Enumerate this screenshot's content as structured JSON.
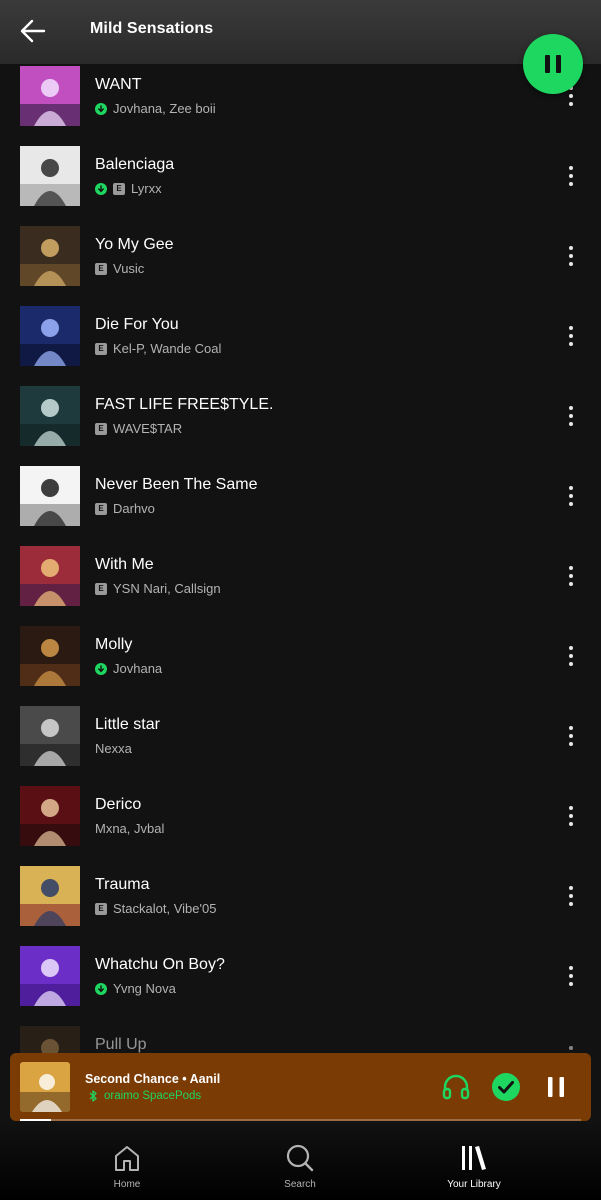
{
  "header": {
    "title": "Mild Sensations"
  },
  "tracks": [
    {
      "title": "WANT",
      "artists": "Jovhana, Zee boii",
      "downloaded": true,
      "explicit": false,
      "art": {
        "bg": "#c24fc0",
        "fg": "#f2e0ff",
        "accent": "#2b1a40"
      }
    },
    {
      "title": "Balenciaga",
      "artists": "Lyrxx",
      "downloaded": true,
      "explicit": true,
      "art": {
        "bg": "#e8e8e8",
        "fg": "#2a2a2a",
        "accent": "#9a9a9a"
      }
    },
    {
      "title": "Yo My Gee",
      "artists": "Vusic",
      "downloaded": false,
      "explicit": true,
      "art": {
        "bg": "#3a2c1e",
        "fg": "#d9b26b",
        "accent": "#7a5a2e"
      }
    },
    {
      "title": "Die For You",
      "artists": "Kel-P, Wande Coal",
      "downloaded": false,
      "explicit": true,
      "art": {
        "bg": "#1b2a6b",
        "fg": "#9fb6ff",
        "accent": "#0a0f2a"
      }
    },
    {
      "title": "FAST LIFE FREE$TYLE.",
      "artists": "WAVE$TAR",
      "downloaded": false,
      "explicit": true,
      "art": {
        "bg": "#1f3a3c",
        "fg": "#cfe3e0",
        "accent": "#0f1f20"
      }
    },
    {
      "title": "Never Been The Same",
      "artists": "Darhvo",
      "downloaded": false,
      "explicit": true,
      "art": {
        "bg": "#f4f4f4",
        "fg": "#1c1c1c",
        "accent": "#7d7d7d"
      }
    },
    {
      "title": "With Me",
      "artists": "YSN Nari, Callsign",
      "downloaded": false,
      "explicit": true,
      "art": {
        "bg": "#9c2c3a",
        "fg": "#f1c27a",
        "accent": "#3c1a4a"
      }
    },
    {
      "title": "Molly",
      "artists": "Jovhana",
      "downloaded": true,
      "explicit": false,
      "art": {
        "bg": "#2a1a12",
        "fg": "#d49a4a",
        "accent": "#6a3a1a"
      }
    },
    {
      "title": "Little star",
      "artists": "Nexxa",
      "downloaded": false,
      "explicit": false,
      "art": {
        "bg": "#4a4a4a",
        "fg": "#dcdcdc",
        "accent": "#1c1c1c"
      }
    },
    {
      "title": "Derico",
      "artists": "Mxna, Jvbal",
      "downloaded": false,
      "explicit": false,
      "art": {
        "bg": "#5a0f14",
        "fg": "#e7c39a",
        "accent": "#1e0a0a"
      }
    },
    {
      "title": "Trauma",
      "artists": "Stackalot, Vibe'05",
      "downloaded": false,
      "explicit": true,
      "art": {
        "bg": "#d8b255",
        "fg": "#2a3b6a",
        "accent": "#8a2a2a"
      }
    },
    {
      "title": "Whatchu On Boy?",
      "artists": "Yvng Nova",
      "downloaded": true,
      "explicit": false,
      "art": {
        "bg": "#6b2fc8",
        "fg": "#efe3ff",
        "accent": "#3a1480"
      }
    },
    {
      "title": "Pull Up",
      "artists": "",
      "downloaded": false,
      "explicit": false,
      "art": {
        "bg": "#3a2a1a",
        "fg": "#c89a5a",
        "accent": "#1a120a"
      }
    }
  ],
  "now_playing": {
    "title": "Second Chance • Aanil",
    "device": "oraimo SpacePods",
    "progress": 0.055,
    "art": {
      "bg": "#d9a441",
      "fg": "#ffffff",
      "accent": "#5a3a1a"
    }
  },
  "nav": [
    {
      "label": "Home",
      "icon": "home-icon",
      "active": false
    },
    {
      "label": "Search",
      "icon": "search-icon",
      "active": false
    },
    {
      "label": "Your Library",
      "icon": "library-icon",
      "active": true
    }
  ],
  "colors": {
    "accent": "#1ed760",
    "background": "#121212",
    "mini_player": "#7a3b05"
  }
}
